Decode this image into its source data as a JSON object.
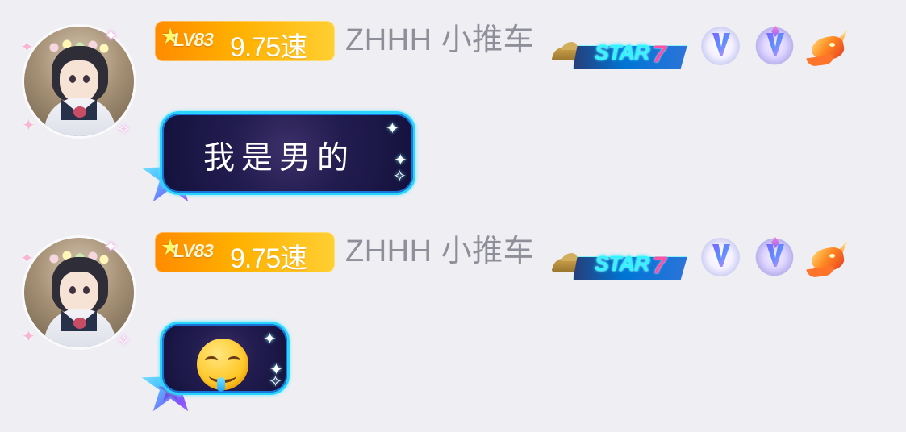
{
  "messages": [
    {
      "level": "LV83",
      "speed": "9.75速",
      "username": "ZHHH 小推车",
      "star_badge": "STAR",
      "star_number": "7",
      "message": "我是男的"
    },
    {
      "level": "LV83",
      "speed": "9.75速",
      "username": "ZHHH 小推车",
      "star_badge": "STAR",
      "star_number": "7",
      "message_icon": "drooling-face-emoji"
    }
  ],
  "icons": {
    "avatar": "anime-girl-avatar",
    "level_star": "star-icon",
    "vip_badge": "v-badge-icon",
    "dragon_badge": "dragon-icon",
    "bubble_star": "purple-star-decoration"
  },
  "colors": {
    "background": "#efeef3",
    "level_badge_start": "#ff8b00",
    "level_badge_end": "#ffcf32",
    "username": "#8e8f98",
    "bubble_border": "#28d5ff",
    "bubble_fill": "#13113c"
  }
}
